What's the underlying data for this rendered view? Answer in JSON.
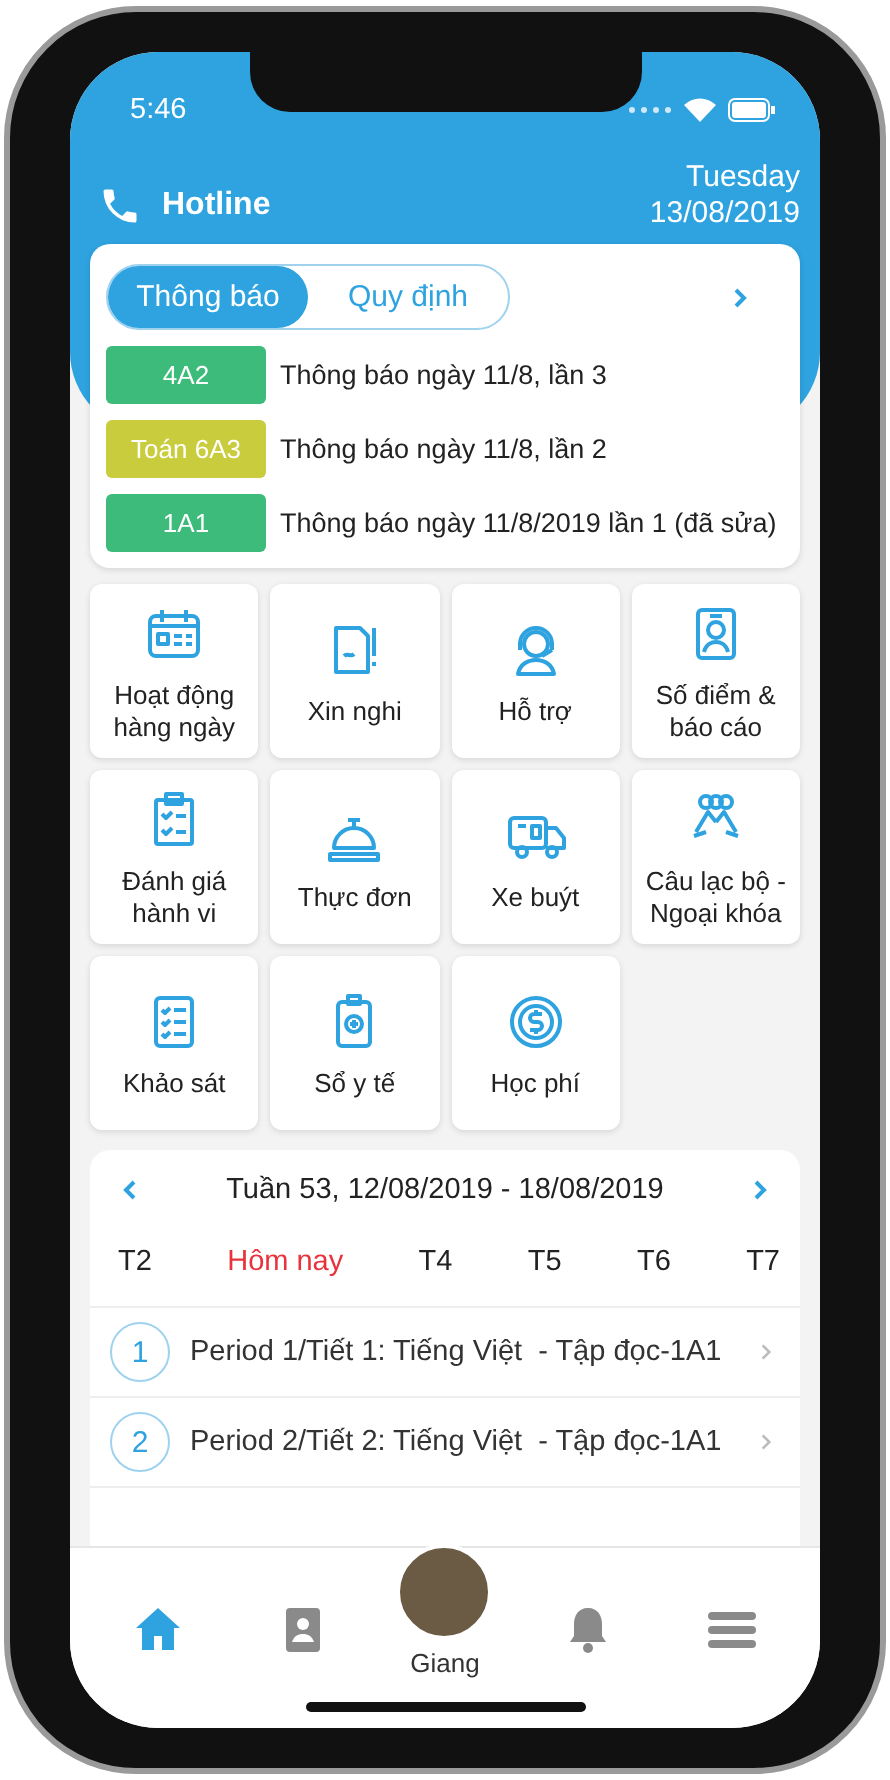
{
  "status_bar": {
    "time": "5:46"
  },
  "header": {
    "hotline": "Hotline",
    "day": "Tuesday",
    "date": "13/08/2019"
  },
  "notices": {
    "tabs": [
      {
        "label": "Thông báo",
        "selected": true
      },
      {
        "label": "Quy định",
        "selected": false
      }
    ],
    "items": [
      {
        "tag": "4A2",
        "color": "#3dbb7a",
        "text": "Thông báo ngày 11/8, lần 3"
      },
      {
        "tag": "Toán 6A3",
        "color": "#c9cc3c",
        "text": "Thông báo ngày 11/8, lần 2"
      },
      {
        "tag": "1A1",
        "color": "#3dbb7a",
        "text": "Thông báo ngày 11/8/2019 lần 1 (đã sửa)"
      }
    ]
  },
  "features": [
    {
      "label": "Hoạt động\nhàng ngày"
    },
    {
      "label": "Xin nghi"
    },
    {
      "label": "Hỗ trợ"
    },
    {
      "label": "Số điểm &\nbáo cáo"
    },
    {
      "label": "Đánh giá\nhành vi"
    },
    {
      "label": "Thực đơn"
    },
    {
      "label": "Xe buýt"
    },
    {
      "label": "Câu lạc bộ -\nNgoại khóa"
    },
    {
      "label": "Khảo sát"
    },
    {
      "label": "Sổ y tế"
    },
    {
      "label": "Học phí"
    }
  ],
  "schedule": {
    "week": "Tuần 53, 12/08/2019 - 18/08/2019",
    "days": [
      {
        "label": "T2",
        "selected": false
      },
      {
        "label": "Hôm nay",
        "selected": true
      },
      {
        "label": "T4",
        "selected": false
      },
      {
        "label": "T5",
        "selected": false
      },
      {
        "label": "T6",
        "selected": false
      },
      {
        "label": "T7",
        "selected": false
      }
    ],
    "periods": [
      {
        "number": "1",
        "text": "Period 1/Tiết 1: Tiếng Việt  - Tập đọc-1A1"
      },
      {
        "number": "2",
        "text": "Period 2/Tiết 2: Tiếng Việt  - Tập đọc-1A1"
      }
    ]
  },
  "tab_bar": {
    "items": [
      {
        "kind": "home",
        "selected": true
      },
      {
        "kind": "contacts",
        "selected": false
      },
      {
        "kind": "profile",
        "label": "Giang",
        "selected": false
      },
      {
        "kind": "notifications",
        "selected": false
      },
      {
        "kind": "menu",
        "selected": false
      }
    ]
  }
}
